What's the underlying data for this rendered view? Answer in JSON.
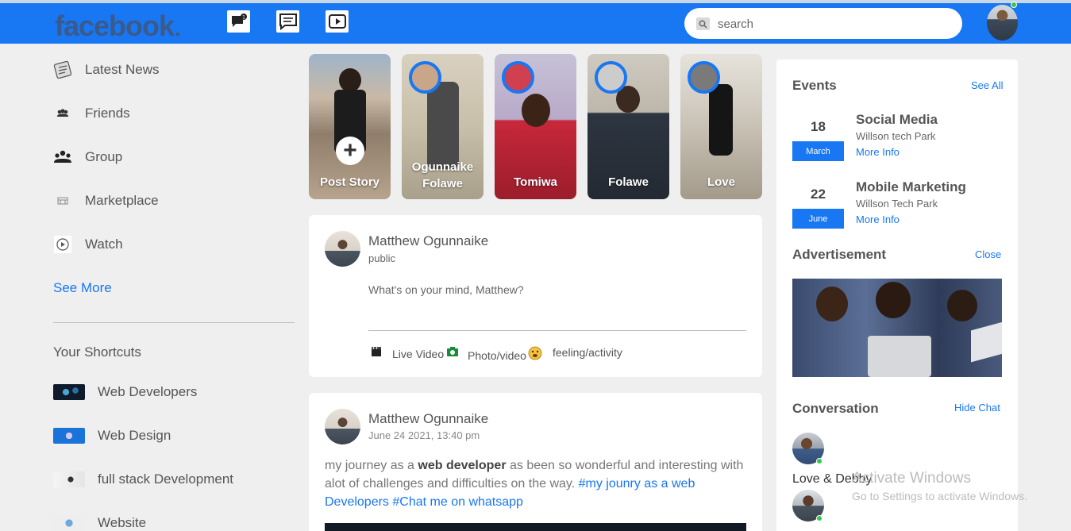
{
  "header": {
    "logo": "facebook",
    "search_placeholder": "search",
    "nav_icons": [
      "notification-chat-icon",
      "message-icon",
      "video-play-icon"
    ],
    "brand_color": "#1877f2"
  },
  "sidebar": {
    "items": [
      {
        "label": "Latest News",
        "icon": "news-icon"
      },
      {
        "label": "Friends",
        "icon": "friends-icon"
      },
      {
        "label": "Group",
        "icon": "group-icon"
      },
      {
        "label": "Marketplace",
        "icon": "marketplace-icon"
      },
      {
        "label": "Watch",
        "icon": "watch-icon"
      }
    ],
    "see_more": "See More",
    "shortcuts_title": "Your Shortcuts",
    "shortcuts": [
      {
        "label": "Web Developers"
      },
      {
        "label": "Web Design"
      },
      {
        "label": "full stack Development"
      },
      {
        "label": "Website"
      }
    ]
  },
  "stories": [
    {
      "name": "Post Story",
      "own": true
    },
    {
      "name": "Ogunnaike Folawe"
    },
    {
      "name": "Tomiwa"
    },
    {
      "name": "Folawe"
    },
    {
      "name": "Love"
    }
  ],
  "composer": {
    "author": "Matthew Ogunnaike",
    "visibility": "public",
    "prompt": "What's on your mind, Matthew?",
    "actions": [
      "Live Video",
      "Photo/video",
      "feeling/activity"
    ]
  },
  "post": {
    "author": "Matthew Ogunnaike",
    "date": "June 24 2021, 13:40 pm",
    "text_start": "my journey as a ",
    "text_bold": "web developer",
    "text_mid": " as been so wonderful and interesting with alot of challenges and difficulties on the way. ",
    "hashtag1": "#my jounry as a web Developers",
    "hashtag2": "#Chat me on whatsapp"
  },
  "events": {
    "title": "Events",
    "see_all": "See All",
    "items": [
      {
        "day": "18",
        "month": "March",
        "title": "Social Media",
        "place": "Willson tech Park",
        "more": "More Info"
      },
      {
        "day": "22",
        "month": "June",
        "title": "Mobile Marketing",
        "place": "Willson Tech Park",
        "more": "More Info"
      }
    ]
  },
  "advertisement": {
    "title": "Advertisement",
    "close": "Close"
  },
  "conversation": {
    "title": "Conversation",
    "hide": "Hide Chat",
    "contacts": [
      {
        "name": "Love & Debby"
      }
    ]
  },
  "watermark": {
    "line1": "Activate Windows",
    "line2": "Go to Settings to activate Windows."
  }
}
